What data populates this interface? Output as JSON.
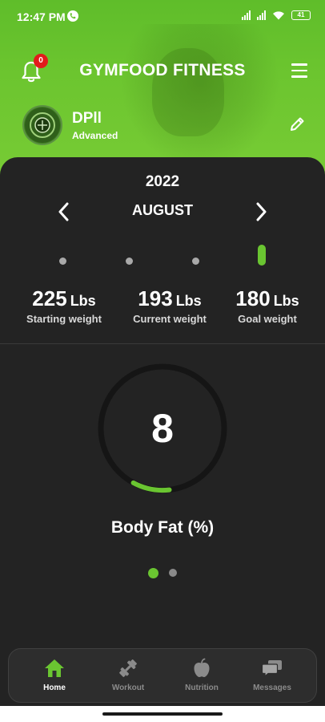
{
  "status_bar": {
    "time": "12:47 PM",
    "battery": "41"
  },
  "header": {
    "title": "GYMFOOD FITNESS",
    "notification_count": "0",
    "bell_icon": "bell-icon",
    "menu_icon": "hamburger-menu-icon",
    "accent_color": "#6ac531"
  },
  "profile": {
    "name": "DPll",
    "level": "Advanced",
    "edit_icon": "pencil-icon"
  },
  "calendar": {
    "year": "2022",
    "month": "AUGUST"
  },
  "weights": [
    {
      "value": "225",
      "unit": "Lbs",
      "label": "Starting weight"
    },
    {
      "value": "193",
      "unit": "Lbs",
      "label": "Current weight"
    },
    {
      "value": "180",
      "unit": "Lbs",
      "label": "Goal weight"
    }
  ],
  "gauge": {
    "value": "8",
    "label": "Body Fat (%)"
  },
  "pager": {
    "current": 1,
    "total": 2
  },
  "nav": {
    "items": [
      {
        "label": "Home",
        "icon": "home-icon",
        "active": true
      },
      {
        "label": "Workout",
        "icon": "dumbbell-icon",
        "active": false
      },
      {
        "label": "Nutrition",
        "icon": "apple-icon",
        "active": false
      },
      {
        "label": "Messages",
        "icon": "chat-icon",
        "active": false
      }
    ]
  }
}
